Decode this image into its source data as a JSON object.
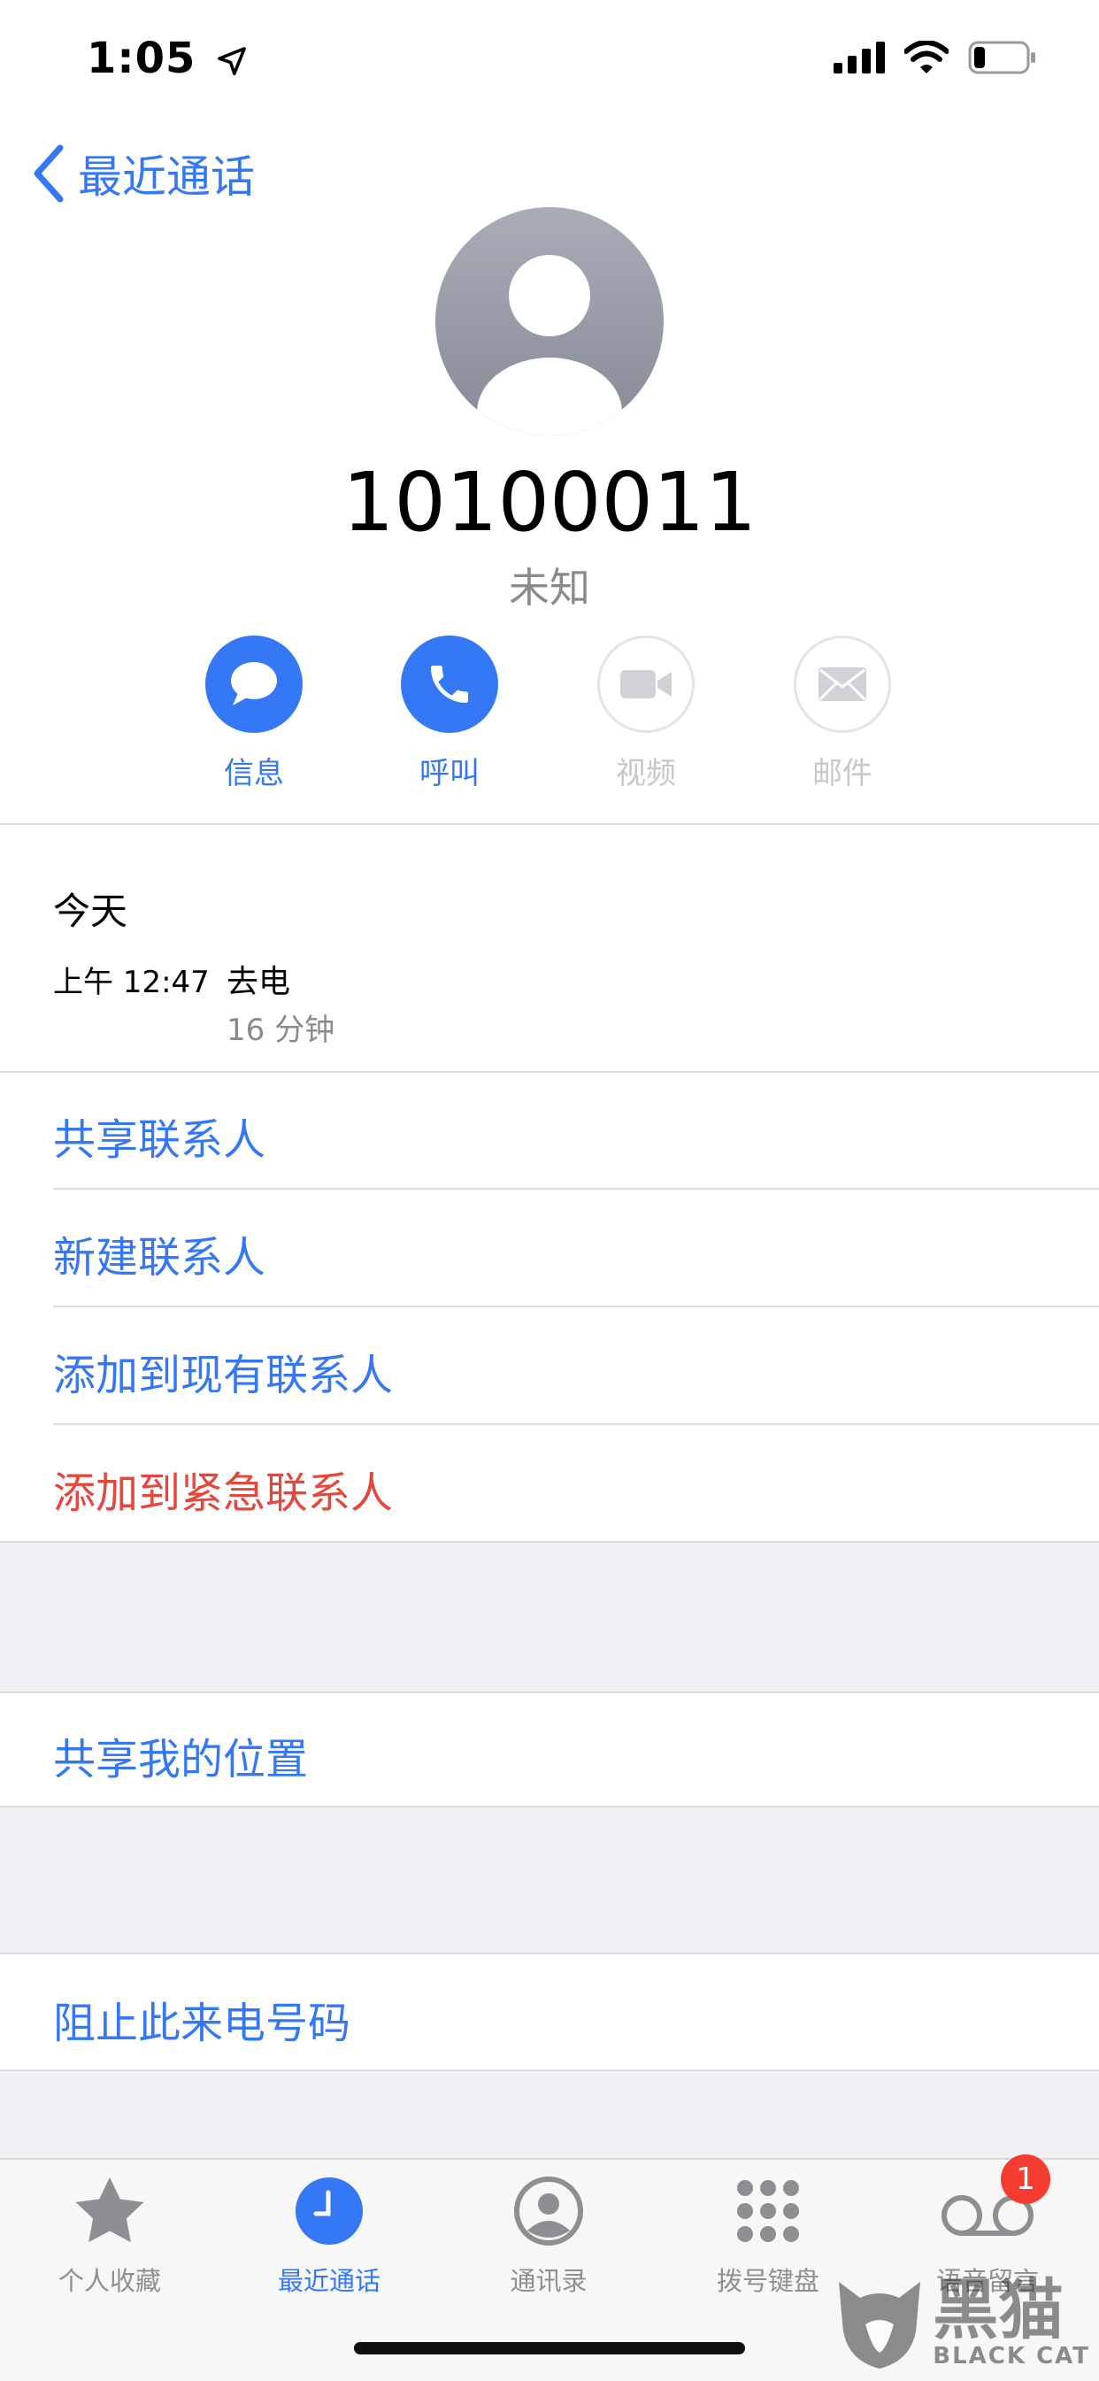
{
  "status": {
    "time": "1:05"
  },
  "nav": {
    "back_label": "最近通话"
  },
  "contact": {
    "number": "10100011",
    "subtitle": "未知"
  },
  "actions": [
    {
      "label": "信息",
      "icon": "message-icon",
      "enabled": true
    },
    {
      "label": "呼叫",
      "icon": "phone-icon",
      "enabled": true
    },
    {
      "label": "视频",
      "icon": "video-icon",
      "enabled": false
    },
    {
      "label": "邮件",
      "icon": "mail-icon",
      "enabled": false
    }
  ],
  "history": {
    "day": "今天",
    "time": "上午 12:47",
    "type": "去电",
    "duration": "16 分钟"
  },
  "options": {
    "share_contact": "共享联系人",
    "new_contact": "新建联系人",
    "add_existing": "添加到现有联系人",
    "add_emergency": "添加到紧急联系人",
    "share_location": "共享我的位置",
    "block": "阻止此来电号码"
  },
  "tabs": [
    {
      "label": "个人收藏",
      "icon": "star-icon"
    },
    {
      "label": "最近通话",
      "icon": "clock-icon",
      "active": true
    },
    {
      "label": "通讯录",
      "icon": "contacts-icon"
    },
    {
      "label": "拨号键盘",
      "icon": "keypad-icon"
    },
    {
      "label": "语音留言",
      "icon": "voicemail-icon",
      "badge": "1"
    }
  ],
  "watermark": {
    "cn": "黑猫",
    "en": "BLACK CAT"
  },
  "colors": {
    "accent": "#3478f6",
    "danger": "#e5473b",
    "badge": "#f43c31"
  }
}
